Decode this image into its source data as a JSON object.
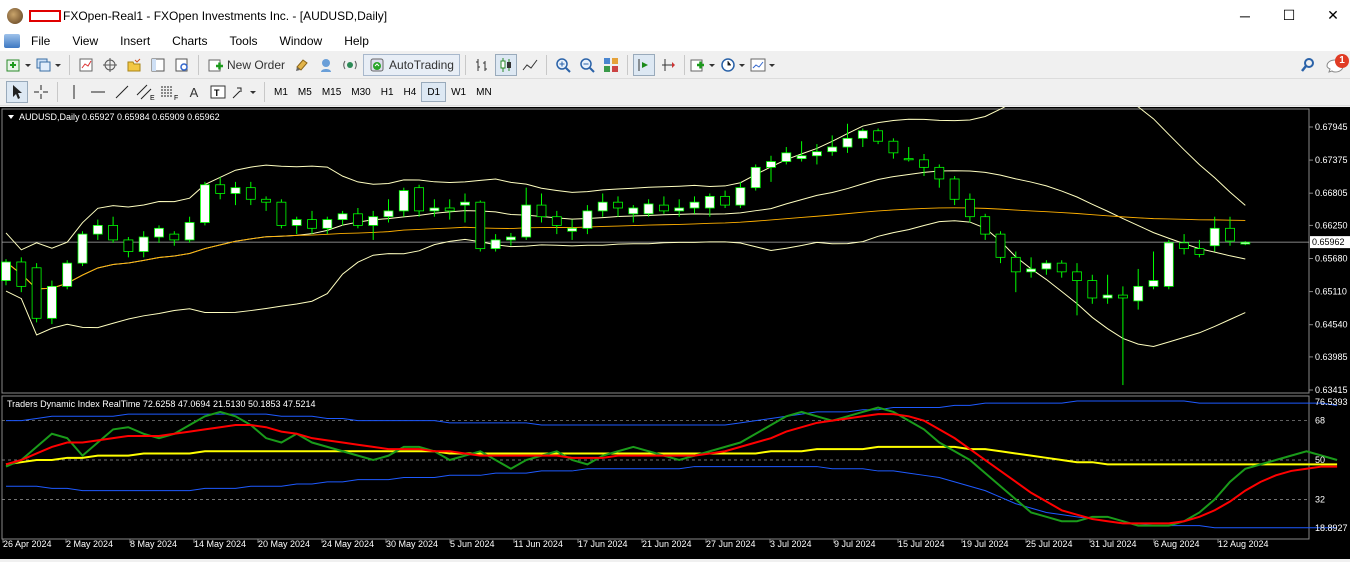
{
  "window": {
    "title": "FXOpen-Real1 - FXOpen Investments Inc. - [AUDUSD,Daily]",
    "minimize": "─",
    "maximize": "☐",
    "close": "✕"
  },
  "menu": [
    "File",
    "View",
    "Insert",
    "Charts",
    "Tools",
    "Window",
    "Help"
  ],
  "toolbar": {
    "new_order": "New Order",
    "autotrading": "AutoTrading",
    "notification_count": "1"
  },
  "timeframes": [
    "M1",
    "M5",
    "M15",
    "M30",
    "H1",
    "H4",
    "D1",
    "W1",
    "MN"
  ],
  "active_timeframe": "D1",
  "chart": {
    "header": "AUDUSD,Daily  0.65927 0.65984 0.65909 0.65962",
    "price_axis": [
      "0.67945",
      "0.67375",
      "0.66805",
      "0.66250",
      "0.65680",
      "0.65110",
      "0.64540",
      "0.63985",
      "0.63415"
    ],
    "current_price": "0.65962",
    "indicator_header": "Traders Dynamic Index RealTime 72.6258 47.0694 21.5130 50.1853 47.5214",
    "indicator_axis": [
      "76.5393",
      "68",
      "50",
      "32",
      "18.8927"
    ],
    "date_axis": [
      "26 Apr 2024",
      "2 May 2024",
      "8 May 2024",
      "14 May 2024",
      "20 May 2024",
      "24 May 2024",
      "30 May 2024",
      "5 Jun 2024",
      "11 Jun 2024",
      "17 Jun 2024",
      "21 Jun 2024",
      "27 Jun 2024",
      "3 Jul 2024",
      "9 Jul 2024",
      "15 Jul 2024",
      "19 Jul 2024",
      "25 Jul 2024",
      "31 Jul 2024",
      "6 Aug 2024",
      "12 Aug 2024"
    ],
    "colors": {
      "bull": "#ffffff",
      "wick": "#00ff00",
      "bands": "#ffffc0",
      "ma": "#ffb000",
      "tdi_green": "#1a9b1a",
      "tdi_red": "#ff0000",
      "tdi_yellow": "#ffff00",
      "tdi_blue": "#1e5aff"
    },
    "candles": [
      [
        0.653,
        0.6567,
        0.6522,
        0.6562
      ],
      [
        0.6562,
        0.657,
        0.651,
        0.652
      ],
      [
        0.6552,
        0.656,
        0.6458,
        0.6465
      ],
      [
        0.6465,
        0.653,
        0.6455,
        0.652
      ],
      [
        0.652,
        0.6565,
        0.6515,
        0.656
      ],
      [
        0.656,
        0.6615,
        0.6555,
        0.661
      ],
      [
        0.661,
        0.6635,
        0.66,
        0.6625
      ],
      [
        0.6625,
        0.664,
        0.6595,
        0.66
      ],
      [
        0.66,
        0.6605,
        0.657,
        0.658
      ],
      [
        0.658,
        0.6615,
        0.657,
        0.6605
      ],
      [
        0.6605,
        0.6625,
        0.6595,
        0.662
      ],
      [
        0.661,
        0.6615,
        0.659,
        0.66
      ],
      [
        0.66,
        0.664,
        0.6595,
        0.663
      ],
      [
        0.663,
        0.67,
        0.6625,
        0.6695
      ],
      [
        0.6695,
        0.6708,
        0.667,
        0.668
      ],
      [
        0.668,
        0.67,
        0.666,
        0.669
      ],
      [
        0.669,
        0.67,
        0.666,
        0.667
      ],
      [
        0.667,
        0.6675,
        0.665,
        0.6665
      ],
      [
        0.6665,
        0.667,
        0.662,
        0.6625
      ],
      [
        0.6625,
        0.664,
        0.661,
        0.6635
      ],
      [
        0.6635,
        0.665,
        0.661,
        0.662
      ],
      [
        0.662,
        0.664,
        0.661,
        0.6635
      ],
      [
        0.6635,
        0.665,
        0.6625,
        0.6645
      ],
      [
        0.6645,
        0.6655,
        0.662,
        0.6625
      ],
      [
        0.6625,
        0.665,
        0.66,
        0.664
      ],
      [
        0.664,
        0.667,
        0.663,
        0.665
      ],
      [
        0.665,
        0.669,
        0.664,
        0.6685
      ],
      [
        0.669,
        0.6695,
        0.664,
        0.665
      ],
      [
        0.665,
        0.667,
        0.664,
        0.6655
      ],
      [
        0.6655,
        0.667,
        0.6635,
        0.665
      ],
      [
        0.666,
        0.668,
        0.663,
        0.6665
      ],
      [
        0.6665,
        0.6668,
        0.658,
        0.6585
      ],
      [
        0.6585,
        0.661,
        0.658,
        0.66
      ],
      [
        0.66,
        0.6612,
        0.659,
        0.6605
      ],
      [
        0.6605,
        0.669,
        0.66,
        0.666
      ],
      [
        0.666,
        0.668,
        0.663,
        0.664
      ],
      [
        0.664,
        0.665,
        0.661,
        0.6625
      ],
      [
        0.6615,
        0.6635,
        0.66,
        0.662
      ],
      [
        0.662,
        0.666,
        0.661,
        0.665
      ],
      [
        0.665,
        0.668,
        0.664,
        0.6665
      ],
      [
        0.6665,
        0.6675,
        0.664,
        0.6655
      ],
      [
        0.6645,
        0.666,
        0.663,
        0.6655
      ],
      [
        0.6645,
        0.667,
        0.664,
        0.6662
      ],
      [
        0.666,
        0.6675,
        0.6645,
        0.665
      ],
      [
        0.665,
        0.667,
        0.664,
        0.6655
      ],
      [
        0.6655,
        0.6675,
        0.6645,
        0.6665
      ],
      [
        0.6655,
        0.668,
        0.664,
        0.6675
      ],
      [
        0.6675,
        0.6685,
        0.6655,
        0.666
      ],
      [
        0.666,
        0.67,
        0.6655,
        0.669
      ],
      [
        0.669,
        0.673,
        0.6685,
        0.6725
      ],
      [
        0.6725,
        0.6745,
        0.67,
        0.6735
      ],
      [
        0.6735,
        0.676,
        0.673,
        0.675
      ],
      [
        0.674,
        0.677,
        0.6735,
        0.6745
      ],
      [
        0.6745,
        0.6765,
        0.673,
        0.6752
      ],
      [
        0.6752,
        0.678,
        0.6745,
        0.676
      ],
      [
        0.676,
        0.68,
        0.675,
        0.6775
      ],
      [
        0.6775,
        0.6792,
        0.676,
        0.6788
      ],
      [
        0.6788,
        0.6792,
        0.6765,
        0.677
      ],
      [
        0.677,
        0.6775,
        0.674,
        0.675
      ],
      [
        0.674,
        0.676,
        0.6735,
        0.6738
      ],
      [
        0.6738,
        0.6748,
        0.671,
        0.6725
      ],
      [
        0.6725,
        0.673,
        0.669,
        0.6705
      ],
      [
        0.6705,
        0.671,
        0.666,
        0.667
      ],
      [
        0.667,
        0.668,
        0.663,
        0.664
      ],
      [
        0.664,
        0.6645,
        0.66,
        0.661
      ],
      [
        0.661,
        0.6615,
        0.656,
        0.657
      ],
      [
        0.657,
        0.658,
        0.651,
        0.6545
      ],
      [
        0.6545,
        0.657,
        0.6535,
        0.655
      ],
      [
        0.655,
        0.6565,
        0.654,
        0.656
      ],
      [
        0.656,
        0.6565,
        0.6535,
        0.6545
      ],
      [
        0.6545,
        0.656,
        0.647,
        0.653
      ],
      [
        0.653,
        0.654,
        0.649,
        0.65
      ],
      [
        0.65,
        0.654,
        0.649,
        0.6505
      ],
      [
        0.6505,
        0.652,
        0.635,
        0.65
      ],
      [
        0.6495,
        0.655,
        0.648,
        0.652
      ],
      [
        0.652,
        0.658,
        0.6515,
        0.653
      ],
      [
        0.652,
        0.66,
        0.6515,
        0.6595
      ],
      [
        0.6595,
        0.661,
        0.6575,
        0.6585
      ],
      [
        0.6585,
        0.66,
        0.657,
        0.6575
      ],
      [
        0.659,
        0.664,
        0.658,
        0.662
      ],
      [
        0.662,
        0.664,
        0.659,
        0.6598
      ],
      [
        0.6593,
        0.6598,
        0.6591,
        0.6596
      ]
    ],
    "tdi": {
      "green": [
        47,
        50,
        56,
        62,
        60,
        52,
        58,
        64,
        65,
        62,
        60,
        62,
        66,
        70,
        72,
        70,
        66,
        60,
        58,
        62,
        58,
        56,
        54,
        52,
        50,
        52,
        56,
        56,
        54,
        50,
        52,
        54,
        50,
        46,
        50,
        52,
        54,
        50,
        48,
        52,
        54,
        56,
        54,
        52,
        50,
        52,
        54,
        56,
        58,
        62,
        66,
        70,
        72,
        70,
        68,
        70,
        72,
        74,
        72,
        68,
        64,
        58,
        54,
        50,
        44,
        38,
        32,
        26,
        24,
        22,
        22,
        24,
        24,
        22,
        20,
        20,
        20,
        22,
        26,
        32,
        40,
        46,
        48,
        50,
        52,
        54,
        52,
        50
      ],
      "red": [
        48,
        50,
        53,
        56,
        58,
        58,
        59,
        60,
        61,
        61,
        61,
        62,
        63,
        64,
        65,
        66,
        66,
        65,
        63,
        62,
        60,
        59,
        58,
        57,
        56,
        55,
        55,
        55,
        54,
        54,
        53,
        52,
        52,
        52,
        52,
        52,
        52,
        51,
        51,
        51,
        52,
        52,
        52,
        52,
        52,
        52,
        53,
        54,
        56,
        58,
        60,
        63,
        65,
        67,
        68,
        69,
        70,
        71,
        71,
        70,
        68,
        64,
        60,
        55,
        50,
        45,
        40,
        35,
        31,
        27,
        25,
        23,
        22,
        21,
        21,
        21,
        21,
        22,
        24,
        27,
        31,
        36,
        40,
        43,
        45,
        46,
        47,
        47
      ],
      "yellow": [
        48,
        49,
        50,
        50,
        51,
        51,
        52,
        52,
        52,
        53,
        53,
        53,
        53,
        54,
        54,
        54,
        54,
        54,
        54,
        54,
        54,
        54,
        54,
        54,
        54,
        54,
        54,
        54,
        54,
        53,
        53,
        53,
        53,
        53,
        53,
        53,
        53,
        53,
        53,
        53,
        53,
        53,
        53,
        53,
        53,
        53,
        53,
        53,
        53,
        53,
        54,
        54,
        54,
        55,
        55,
        55,
        55,
        56,
        56,
        56,
        56,
        56,
        56,
        55,
        55,
        54,
        53,
        52,
        51,
        50,
        49,
        49,
        48,
        48,
        48,
        48,
        48,
        48,
        48,
        48,
        48,
        48,
        48,
        48,
        48,
        48,
        48,
        48
      ],
      "upper": [
        68,
        68,
        69,
        70,
        70,
        70,
        70,
        70,
        71,
        71,
        71,
        71,
        71,
        71,
        71,
        71,
        71,
        71,
        70,
        70,
        70,
        69,
        69,
        68,
        68,
        68,
        68,
        68,
        68,
        67,
        67,
        67,
        67,
        67,
        67,
        66,
        66,
        66,
        66,
        66,
        66,
        66,
        66,
        66,
        66,
        66,
        66,
        66,
        67,
        68,
        69,
        70,
        71,
        72,
        72,
        72,
        73,
        73,
        74,
        74,
        74,
        74,
        75,
        75,
        76,
        76,
        76,
        76,
        76,
        76,
        77,
        77,
        77,
        77,
        77,
        77,
        77,
        77,
        76,
        76,
        76,
        76,
        76,
        76,
        76,
        76,
        76,
        75
      ],
      "lower": [
        38,
        38,
        38,
        37,
        37,
        36,
        36,
        36,
        36,
        36,
        36,
        36,
        36,
        37,
        37,
        37,
        38,
        38,
        38,
        39,
        39,
        40,
        40,
        41,
        41,
        41,
        42,
        42,
        42,
        43,
        43,
        43,
        44,
        44,
        44,
        45,
        45,
        45,
        46,
        46,
        46,
        46,
        46,
        46,
        46,
        47,
        47,
        47,
        47,
        47,
        47,
        47,
        47,
        47,
        46,
        46,
        46,
        45,
        45,
        44,
        43,
        42,
        40,
        38,
        36,
        33,
        30,
        28,
        26,
        25,
        24,
        23,
        22,
        21,
        21,
        20,
        20,
        20,
        20,
        19,
        19,
        19,
        19,
        19,
        19,
        19,
        19,
        19
      ]
    }
  }
}
